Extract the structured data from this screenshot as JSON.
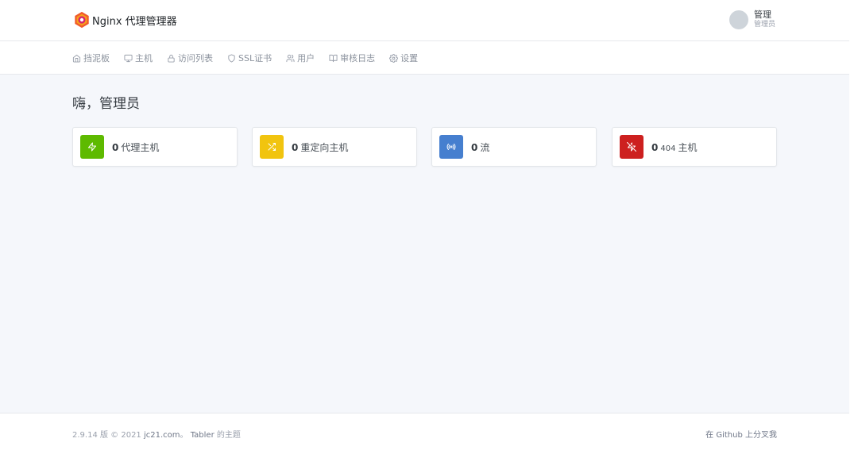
{
  "header": {
    "brand_name": "Nginx 代理管理器",
    "user_name": "管理",
    "user_role": "管理员"
  },
  "nav": {
    "items": [
      {
        "label": "挡泥板",
        "icon": "home-icon"
      },
      {
        "label": "主机",
        "icon": "monitor-icon"
      },
      {
        "label": "访问列表",
        "icon": "lock-icon"
      },
      {
        "label": "SSL证书",
        "icon": "shield-icon"
      },
      {
        "label": "用户",
        "icon": "users-icon"
      },
      {
        "label": "审核日志",
        "icon": "book-icon"
      },
      {
        "label": "设置",
        "icon": "gear-icon"
      }
    ]
  },
  "greeting": "嗨，管理员",
  "cards": [
    {
      "count": "0",
      "prefix": "",
      "label": "代理主机",
      "color": "#5eba00",
      "icon": "zap-icon"
    },
    {
      "count": "0",
      "prefix": "",
      "label": "重定向主机",
      "color": "#f1c40f",
      "icon": "shuffle-icon"
    },
    {
      "count": "0",
      "prefix": "",
      "label": "流",
      "color": "#467fcf",
      "icon": "radio-icon"
    },
    {
      "count": "0",
      "prefix": "404",
      "label": "主机",
      "color": "#cd201f",
      "icon": "zap-off-icon"
    }
  ],
  "footer": {
    "version_text": "2.9.14 版 © 2021",
    "site_link": "jc21.com",
    "sep": "。",
    "theme_link": "Tabler",
    "theme_suffix": "的主题",
    "github_text": "在 Github 上分叉我"
  }
}
